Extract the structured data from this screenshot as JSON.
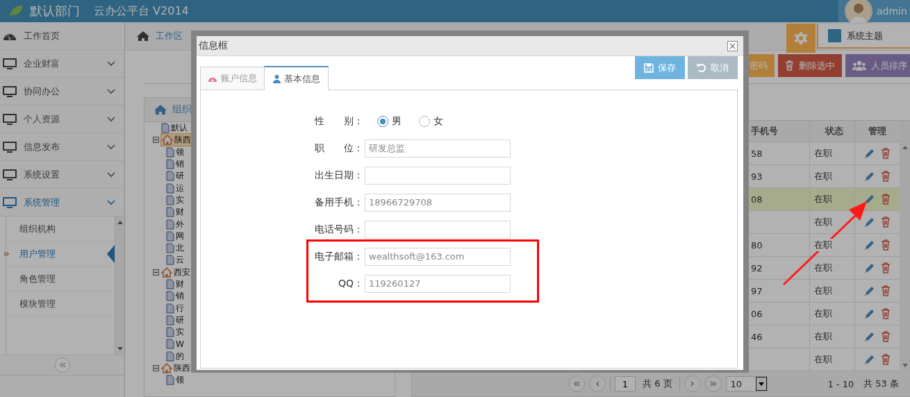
{
  "header": {
    "dept": "默认部门",
    "title": "云办公平台 V2014",
    "user": "admin"
  },
  "sidebar": {
    "items": [
      {
        "label": "工作首页",
        "kind": "home",
        "selected": false
      },
      {
        "label": "企业财富",
        "kind": "menu",
        "expanded": false,
        "selected": false
      },
      {
        "label": "协同办公",
        "kind": "menu",
        "expanded": false,
        "selected": false
      },
      {
        "label": "个人资源",
        "kind": "menu",
        "expanded": false,
        "selected": false
      },
      {
        "label": "信息发布",
        "kind": "menu",
        "expanded": false,
        "selected": false
      },
      {
        "label": "系统设置",
        "kind": "menu",
        "expanded": false,
        "selected": false
      },
      {
        "label": "系统管理",
        "kind": "menu",
        "expanded": true,
        "selected": true,
        "children": [
          {
            "label": "组织机构",
            "selected": false
          },
          {
            "label": "用户管理",
            "selected": true
          },
          {
            "label": "角色管理",
            "selected": false
          },
          {
            "label": "模块管理",
            "selected": false
          }
        ]
      }
    ]
  },
  "breadcrumb": "工作区",
  "theme": "系统主题",
  "toolbar": [
    {
      "label": "密码",
      "kind": "password"
    },
    {
      "label": "删除选中",
      "kind": "delete"
    },
    {
      "label": "人员排序",
      "kind": "sort"
    }
  ],
  "tree": {
    "title": "组织",
    "nodes": [
      {
        "label": "默认",
        "kind": "leaf",
        "selected": false
      },
      {
        "label": "陕西",
        "kind": "folder",
        "expanded": true,
        "selected": true,
        "children": [
          "领",
          "销",
          "研",
          "运",
          "实",
          "财",
          "外",
          "网",
          "北",
          "云"
        ]
      },
      {
        "label": "西安",
        "kind": "folder",
        "expanded": true,
        "selected": false,
        "children": [
          "财",
          "销",
          "行",
          "研",
          "实",
          "W",
          "的"
        ]
      },
      {
        "label": "陕西",
        "kind": "folder",
        "expanded": true,
        "selected": false,
        "children": [
          "领"
        ]
      }
    ]
  },
  "table": {
    "columns": [
      "手机号",
      "状态",
      "管理"
    ],
    "rows": [
      {
        "phone": "58",
        "status": "在职",
        "selected": false
      },
      {
        "phone": "93",
        "status": "在职",
        "selected": false
      },
      {
        "phone": "08",
        "status": "在职",
        "selected": true
      },
      {
        "phone": "",
        "status": "在职",
        "selected": false
      },
      {
        "phone": "80",
        "status": "在职",
        "selected": false
      },
      {
        "phone": "92",
        "status": "在职",
        "selected": false
      },
      {
        "phone": "97",
        "status": "在职",
        "selected": false
      },
      {
        "phone": "06",
        "status": "在职",
        "selected": false
      },
      {
        "phone": "46",
        "status": "在职",
        "selected": false
      },
      {
        "phone": "",
        "status": "在职",
        "selected": false
      }
    ]
  },
  "pagination": {
    "page": "1",
    "pages": "共 6 页",
    "size": "10",
    "range": "1 - 10",
    "total": "共 53 条"
  },
  "modal": {
    "title": "信息框",
    "tabs": [
      {
        "label": "账户信息",
        "kind": "account",
        "selected": false
      },
      {
        "label": "基本信息",
        "kind": "basic",
        "selected": true
      }
    ],
    "buttons": [
      {
        "label": "保存",
        "kind": "save"
      },
      {
        "label": "取消",
        "kind": "cancel"
      }
    ],
    "gender": {
      "label": "性　　别：",
      "options": [
        {
          "label": "男",
          "selected": true
        },
        {
          "label": "女",
          "selected": false
        }
      ]
    },
    "fields": [
      {
        "label": "职　　位：",
        "value": "研发总监"
      },
      {
        "label": "出生日期："
      },
      {
        "label": "备用手机：",
        "value": "18966729708"
      },
      {
        "label": "电话号码："
      },
      {
        "label": "电子邮箱：",
        "value": "wealthsoft@163.com"
      },
      {
        "label": "QQ：",
        "value": "119260127"
      }
    ]
  }
}
